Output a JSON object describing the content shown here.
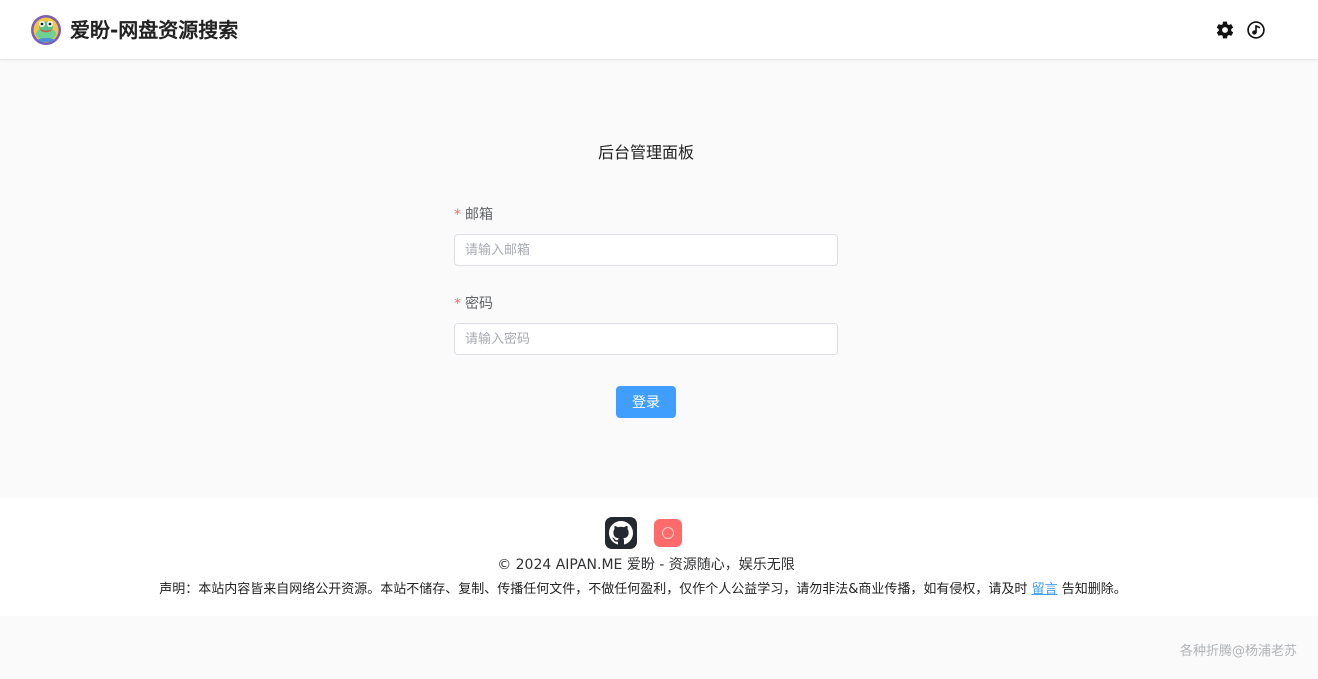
{
  "header": {
    "brand": "爱盼-网盘资源搜索",
    "logo_icon": "frog-logo-icon",
    "settings_icon": "gear-icon",
    "music_icon": "music-note-icon"
  },
  "main": {
    "title": "后台管理面板",
    "email": {
      "required_mark": "*",
      "label": "邮箱",
      "placeholder": "请输入邮箱",
      "value": ""
    },
    "password": {
      "required_mark": "*",
      "label": "密码",
      "placeholder": "请输入密码",
      "value": ""
    },
    "login_button": "登录"
  },
  "footer": {
    "github_icon": "github-icon",
    "app_icon": "app-icon",
    "copyright": "© 2024 AIPAN.ME 爱盼 - 资源随心，娱乐无限",
    "disclaimer_before": "声明：本站内容皆来自网络公开资源。本站不储存、复制、传播任何文件，不做任何盈利，仅作个人公益学习，请勿非法&商业传播，如有侵权，请及时 ",
    "disclaimer_link": "留言",
    "disclaimer_after": " 告知删除。"
  },
  "watermark": "各种折腾@杨浦老苏",
  "colors": {
    "primary": "#409eff",
    "required": "#f56c6c",
    "github_bg": "#24292f",
    "app_bg": "#ff6b6b"
  }
}
